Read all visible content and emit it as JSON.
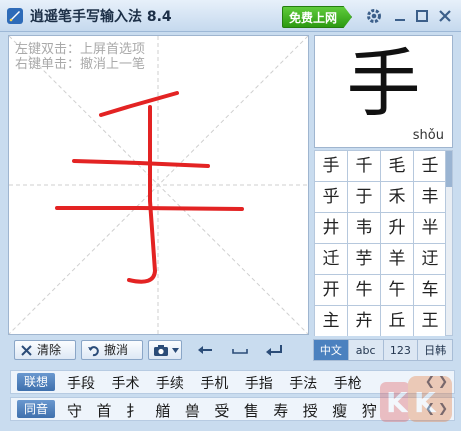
{
  "window": {
    "title": "逍遥笔手写输入法 8.4",
    "free_online_label": "免费上网"
  },
  "canvas": {
    "hint_left_double": "左键双击：上屏首选项",
    "hint_right_single": "右键单击：撤消上一笔"
  },
  "recognized": {
    "character": "手",
    "pinyin": "shǒu"
  },
  "candidates": [
    "手",
    "千",
    "毛",
    "壬",
    "乎",
    "于",
    "禾",
    "丰",
    "井",
    "韦",
    "升",
    "半",
    "迁",
    "芋",
    "羊",
    "迂",
    "开",
    "牛",
    "午",
    "车",
    "主",
    "卉",
    "丘",
    "王"
  ],
  "toolbar": {
    "clear_label": "清除",
    "undo_label": "撤消"
  },
  "modes": [
    "中文",
    "abc",
    "123",
    "日韩"
  ],
  "association": {
    "label": "联想",
    "words": [
      "手段",
      "手术",
      "手续",
      "手机",
      "手指",
      "手法",
      "手枪"
    ]
  },
  "homophones": {
    "label": "同音",
    "chars": [
      "守",
      "首",
      "扌",
      "艏",
      "兽",
      "受",
      "售",
      "寿",
      "授",
      "瘦",
      "狩"
    ]
  },
  "watermark_text": "KK下载",
  "colors": {
    "stroke": "#e32323",
    "accent_green": "#3aa61c",
    "mode_active": "#4b81bf"
  },
  "icons": [
    "app-logo-icon",
    "settings-gear-icon",
    "minimize-icon",
    "maximize-icon",
    "close-icon",
    "clear-x-icon",
    "undo-arrow-icon",
    "camera-icon",
    "dropdown-arrow-icon",
    "backspace-arrow-icon",
    "space-icon",
    "enter-icon",
    "prev-page-icon",
    "next-page-icon"
  ]
}
